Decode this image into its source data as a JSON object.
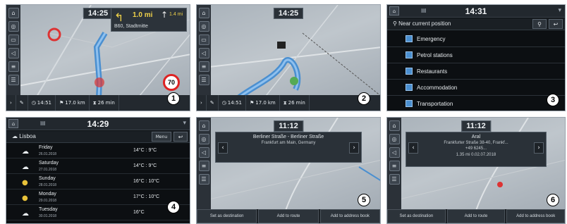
{
  "panel1": {
    "time": "14:25",
    "turn_distance": "1.0",
    "turn_unit": "mi",
    "next_distance": "1.4",
    "next_unit": "mi",
    "street": "B60, Stadtmitte",
    "speed_limit": "70",
    "status": [
      "14:51",
      "17.0",
      "26"
    ],
    "status_units": [
      "",
      "km",
      "min"
    ],
    "badge": "1"
  },
  "panel2": {
    "time": "14:25",
    "status": [
      "14:51",
      "17.0",
      "26"
    ],
    "status_units": [
      "",
      "km",
      "min"
    ],
    "badge": "2"
  },
  "panel3": {
    "time": "14:31",
    "search_label": "Near current position",
    "categories": [
      "Emergency",
      "Petrol stations",
      "Restaurants",
      "Accommodation",
      "Transportation"
    ],
    "badge": "3"
  },
  "panel4": {
    "time": "14:29",
    "city": "Lisboa",
    "menu_label": "Menu",
    "days": [
      {
        "day": "Friday",
        "date": "26.01.2018",
        "temp": "14°C : 9°C",
        "icon": "☁"
      },
      {
        "day": "Saturday",
        "date": "27.01.2018",
        "temp": "14°C : 9°C",
        "icon": "☁"
      },
      {
        "day": "Sunday",
        "date": "28.01.2018",
        "temp": "16°C : 10°C",
        "icon": "●"
      },
      {
        "day": "Monday",
        "date": "29.01.2018",
        "temp": "17°C : 10°C",
        "icon": "●"
      },
      {
        "day": "Tuesday",
        "date": "30.01.2018",
        "temp": "16°C",
        "icon": "☁"
      }
    ],
    "badge": "4"
  },
  "panel5": {
    "time": "11:12",
    "line1": "Berliner Straße - Berliner Straße",
    "line2": "Frankfurt am Main, Germany",
    "actions": [
      "Set as destination",
      "Add to route",
      "Add to address book"
    ],
    "badge": "5"
  },
  "panel6": {
    "time": "11:12",
    "line1": "Aral",
    "line2": "Frankfurter Straße 38-40, Frankf...",
    "line3": "+49 6245...",
    "line4": "1.35 mi  0.02.07.2018",
    "actions": [
      "Set as destination",
      "Add to route",
      "Add to address book"
    ],
    "badge": "6"
  }
}
